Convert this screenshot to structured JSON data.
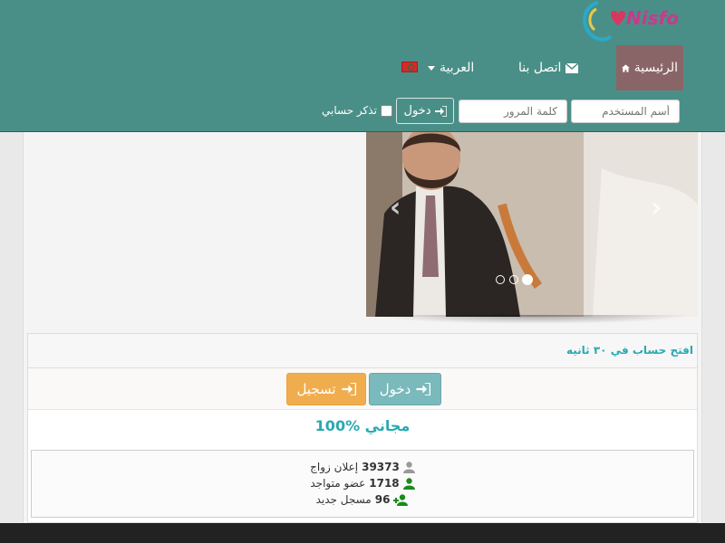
{
  "brand": {
    "logo_text": "Nisfo"
  },
  "nav": {
    "home": "الرئيسية",
    "contact": "اتصل بنا",
    "language": "العربية"
  },
  "login_form": {
    "username_placeholder": "أسم المستخدم",
    "password_placeholder": "كلمة المرور",
    "login_label": "دخول",
    "remember_label": "تذكر حسابي"
  },
  "carousel": {
    "slides": 3,
    "active_slide": 3
  },
  "panel": {
    "heading": "افتح حساب في ٣٠ ثانيه",
    "login_button": "دخول",
    "register_button": "تسجيل",
    "free_text": "100% مجاني"
  },
  "stats": [
    {
      "count": "39373",
      "label": "إعلان زواج",
      "icon": "user-icon"
    },
    {
      "count": "1718",
      "label": "عضو متواجد",
      "icon": "user-online-icon"
    },
    {
      "count": "96",
      "label": "مسجل جديد",
      "icon": "user-plus-icon"
    }
  ],
  "colors": {
    "header": "#4a8f87",
    "home_active": "#8a6567",
    "accent_teal": "#2aa9b2",
    "login_btn": "#7ab9bc",
    "register_btn": "#f0ad4e"
  }
}
